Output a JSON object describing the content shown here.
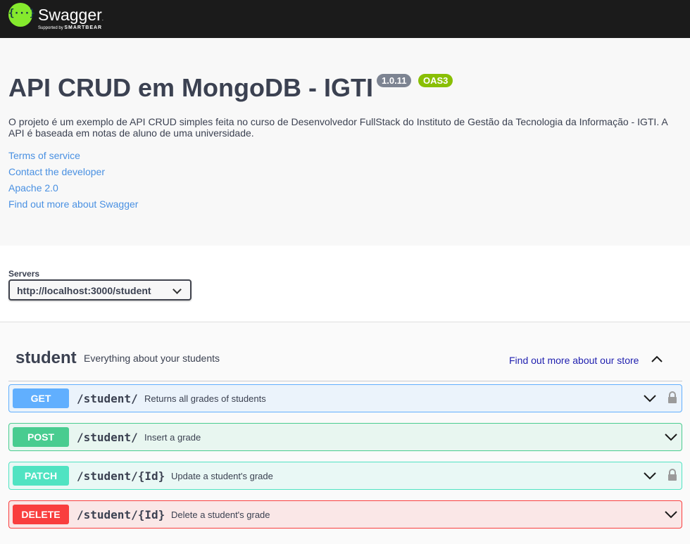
{
  "brand": {
    "logo_glyph": "{···}",
    "name": "Swagger",
    "trademark": ".",
    "supported_by": "Supported by",
    "company": "SMARTBEAR"
  },
  "info": {
    "title": "API CRUD em MongoDB - IGTI",
    "version": "1.0.11",
    "oas": "OAS3",
    "description": "O projeto é um exemplo de API CRUD simples feita no curso de Desenvolvedor FullStack do Instituto de Gestão da Tecnologia da Informação - IGTI. A API é baseada em notas de aluno de uma universidade.",
    "links": [
      "Terms of service",
      "Contact the developer",
      "Apache 2.0",
      "Find out more about Swagger"
    ]
  },
  "servers": {
    "label": "Servers",
    "selected": "http://localhost:3000/student"
  },
  "tag": {
    "name": "student",
    "description": "Everything about your students",
    "link": "Find out more about our store"
  },
  "operations": [
    {
      "method": "GET",
      "path": "/student/",
      "summary": "Returns all grades of students",
      "locked": true
    },
    {
      "method": "POST",
      "path": "/student/",
      "summary": "Insert a grade",
      "locked": false
    },
    {
      "method": "PATCH",
      "path": "/student/{Id}",
      "summary": "Update a student's grade",
      "locked": true
    },
    {
      "method": "DELETE",
      "path": "/student/{Id}",
      "summary": "Delete a student's grade",
      "locked": false
    }
  ],
  "colors": {
    "get": "#61affe",
    "post": "#49cc90",
    "patch": "#50e3c2",
    "delete": "#f93e3e",
    "link": "#4990e2",
    "brand_green": "#85ea2d"
  },
  "icons": {
    "logo": "swagger-logo-icon",
    "server_dropdown": "chevron-down-icon",
    "tag_toggle": "chevron-up-icon",
    "op_expand": "chevron-down-icon",
    "op_auth": "lock-icon"
  }
}
